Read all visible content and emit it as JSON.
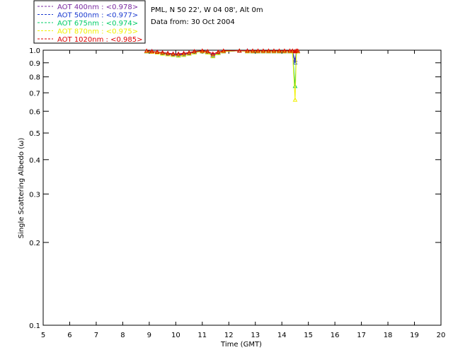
{
  "header": {
    "site": "PML, N 50 22', W 04 08', Alt 0m",
    "date": "Data from: 30 Oct 2004"
  },
  "legend": [
    {
      "text": "AOT  400nm : <0.978>",
      "color": "#7a2aa0"
    },
    {
      "text": "AOT  500nm : <0.977>",
      "color": "#1a3ad0"
    },
    {
      "text": "AOT  675nm : <0.974>",
      "color": "#00cc66"
    },
    {
      "text": "AOT  870nm : <0.975>",
      "color": "#f0f000"
    },
    {
      "text": "AOT 1020nm : <0.985>",
      "color": "#dd0000"
    }
  ],
  "chart_data": {
    "type": "line",
    "xlabel": "Time (GMT)",
    "ylabel": "Single Scattering Albedo (ω)",
    "xlim": [
      5,
      20
    ],
    "ylim": [
      0.1,
      1.0
    ],
    "yscale": "log",
    "xticks": [
      "5",
      "6",
      "7",
      "8",
      "9",
      "10",
      "11",
      "12",
      "13",
      "14",
      "15",
      "16",
      "17",
      "18",
      "19",
      "20"
    ],
    "yticks": [
      "0.1",
      "0.2",
      "0.3",
      "0.4",
      "0.5",
      "0.6",
      "0.7",
      "0.8",
      "0.9",
      "1.0"
    ],
    "x": [
      8.9,
      9.1,
      9.3,
      9.5,
      9.7,
      9.9,
      10.1,
      10.3,
      10.5,
      10.7,
      11.0,
      11.2,
      11.4,
      11.6,
      11.8,
      12.4,
      12.7,
      12.9,
      13.1,
      13.3,
      13.5,
      13.7,
      13.9,
      14.1,
      14.3,
      14.4,
      14.5,
      14.55,
      14.6
    ],
    "series": [
      {
        "name": "AOT  400nm",
        "color": "#7a2aa0",
        "values": [
          0.99,
          0.99,
          0.985,
          0.98,
          0.975,
          0.97,
          0.965,
          0.97,
          0.975,
          0.985,
          0.99,
          0.985,
          0.96,
          0.98,
          0.99,
          0.995,
          0.995,
          0.99,
          0.99,
          0.99,
          0.99,
          0.99,
          0.99,
          0.99,
          0.99,
          0.99,
          0.92,
          0.99,
          0.99
        ]
      },
      {
        "name": "AOT  500nm",
        "color": "#1a3ad0",
        "values": [
          0.99,
          0.99,
          0.985,
          0.975,
          0.97,
          0.965,
          0.96,
          0.965,
          0.975,
          0.985,
          0.99,
          0.985,
          0.955,
          0.975,
          0.99,
          0.995,
          0.995,
          0.99,
          0.99,
          0.99,
          0.99,
          0.99,
          0.99,
          0.99,
          0.99,
          0.99,
          0.9,
          0.99,
          0.99
        ]
      },
      {
        "name": "AOT  675nm",
        "color": "#00cc66",
        "values": [
          0.99,
          0.985,
          0.98,
          0.975,
          0.965,
          0.96,
          0.955,
          0.96,
          0.97,
          0.98,
          0.99,
          0.98,
          0.95,
          0.975,
          0.99,
          0.995,
          0.99,
          0.99,
          0.99,
          0.99,
          0.99,
          0.99,
          0.99,
          0.99,
          0.99,
          0.99,
          0.74,
          0.99,
          0.99
        ]
      },
      {
        "name": "AOT  870nm",
        "color": "#f0f000",
        "values": [
          0.99,
          0.985,
          0.98,
          0.97,
          0.965,
          0.96,
          0.955,
          0.96,
          0.97,
          0.98,
          0.99,
          0.98,
          0.95,
          0.975,
          0.99,
          0.995,
          0.99,
          0.99,
          0.99,
          0.99,
          0.99,
          0.99,
          0.99,
          0.99,
          0.99,
          0.99,
          0.66,
          0.99,
          0.99
        ]
      },
      {
        "name": "AOT 1020nm",
        "color": "#dd0000",
        "values": [
          0.995,
          0.99,
          0.985,
          0.98,
          0.975,
          0.97,
          0.97,
          0.975,
          0.98,
          0.99,
          0.995,
          0.99,
          0.97,
          0.985,
          0.995,
          0.995,
          0.995,
          0.995,
          0.995,
          0.995,
          0.995,
          0.995,
          0.995,
          0.995,
          0.995,
          0.995,
          0.99,
          0.995,
          0.995
        ]
      }
    ]
  }
}
